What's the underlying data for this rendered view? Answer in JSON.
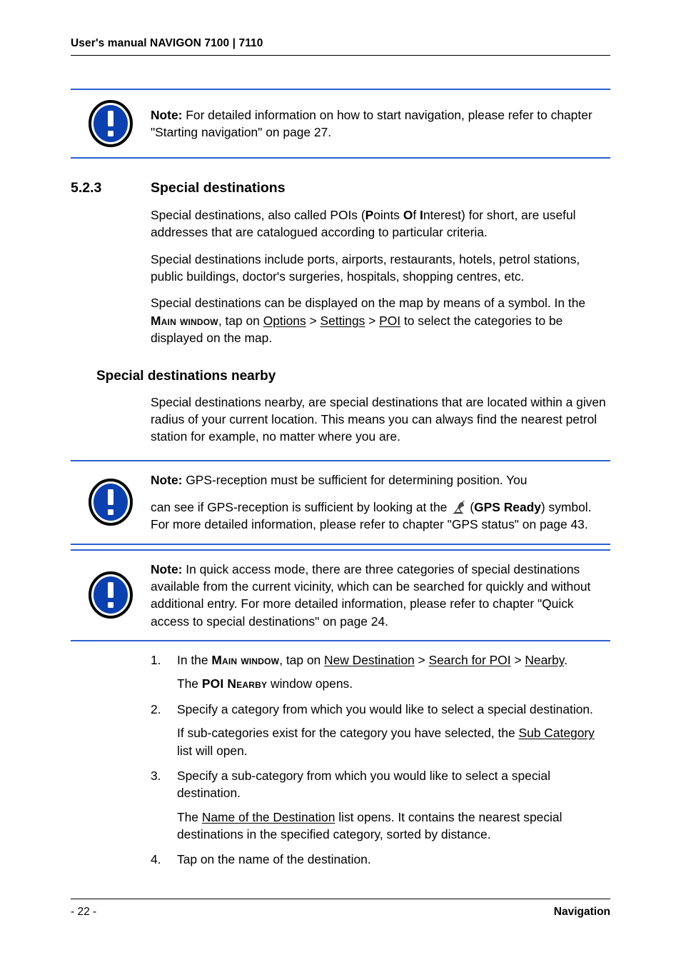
{
  "header": {
    "text": "User's manual NAVIGON 7100 | 7110"
  },
  "colors": {
    "note_rule": "#2b5fd0",
    "note_icon_fill": "#0b40b0",
    "text": "#000000"
  },
  "notes": [
    {
      "icon": "exclamation-note-icon",
      "label": "Note:",
      "text": " For detailed information on how to start navigation, please refer to chapter \"Starting navigation\" on page 27."
    },
    {
      "icon": "exclamation-note-icon",
      "label": "Note:",
      "line1": " GPS-reception must be sufficient for determining position. You",
      "line2_a": "can see if GPS-reception is sufficient by looking at the",
      "gps_icon": "gps-satellite-dish-icon",
      "line2_b": "(",
      "gps_bold": "GPS Ready",
      "line2_c": ") symbol. For more detailed information, please refer to chapter \"GPS status\" on page 43."
    },
    {
      "icon": "exclamation-note-icon",
      "label": "Note:",
      "text": " In quick access mode, there are three categories of special destinations available from the current vicinity, which can be searched for quickly and without additional entry. For more detailed information, please refer to chapter \"Quick access to special destinations\" on page 24."
    }
  ],
  "section": {
    "number": "5.2.3",
    "title": "Special destinations",
    "paragraphs": [
      {
        "a": "Special destinations, also called POIs (",
        "bold1": "P",
        "b": "oints ",
        "bold2": "O",
        "c": "f ",
        "bold3": "I",
        "d": "nterest) for short, are useful addresses that are catalogued according to particular criteria."
      },
      {
        "full": "Special destinations include ports, airports, restaurants, hotels, petrol stations, public buildings, doctor's surgeries, hospitals, shopping centres, etc."
      },
      {
        "a": "Special destinations can be displayed on the map by means of a symbol. In the ",
        "sc": "Main window",
        "b": ", tap on ",
        "u1": "Options",
        "c": " > ",
        "u2": "Settings",
        "d": " > ",
        "u3": "POI",
        "e": " to select the categories to be displayed on the map."
      }
    ]
  },
  "subsection": {
    "title": "Special destinations nearby",
    "paragraph": "Special destinations nearby, are special destinations that are located within a given radius of your current location. This means you can always find the nearest petrol station for example, no matter where you are."
  },
  "steps": [
    {
      "num": "1.",
      "a": "In the ",
      "sc": "Main window",
      "b": ", tap on ",
      "u1": "New Destination",
      "c": " > ",
      "u2": "Search for POI",
      "d": " > ",
      "u3": "Nearby",
      "e": ".",
      "sub_a": "The ",
      "sub_sc": "POI Nearby",
      "sub_b": " window opens."
    },
    {
      "num": "2.",
      "text": "Specify a category from which you would like to select a special destination.",
      "sub_a": "If sub-categories exist for the category you have selected, the ",
      "sub_u": "Sub Category",
      "sub_b": " list will open."
    },
    {
      "num": "3.",
      "text": "Specify a sub-category from which you would like to select a special destination.",
      "sub_a": "The ",
      "sub_u": "Name of the Destination",
      "sub_b": " list opens. It contains the nearest special destinations in the specified category, sorted by distance."
    },
    {
      "num": "4.",
      "text": "Tap on the name of the destination."
    }
  ],
  "footer": {
    "page": "- 22 -",
    "chapter": "Navigation"
  }
}
